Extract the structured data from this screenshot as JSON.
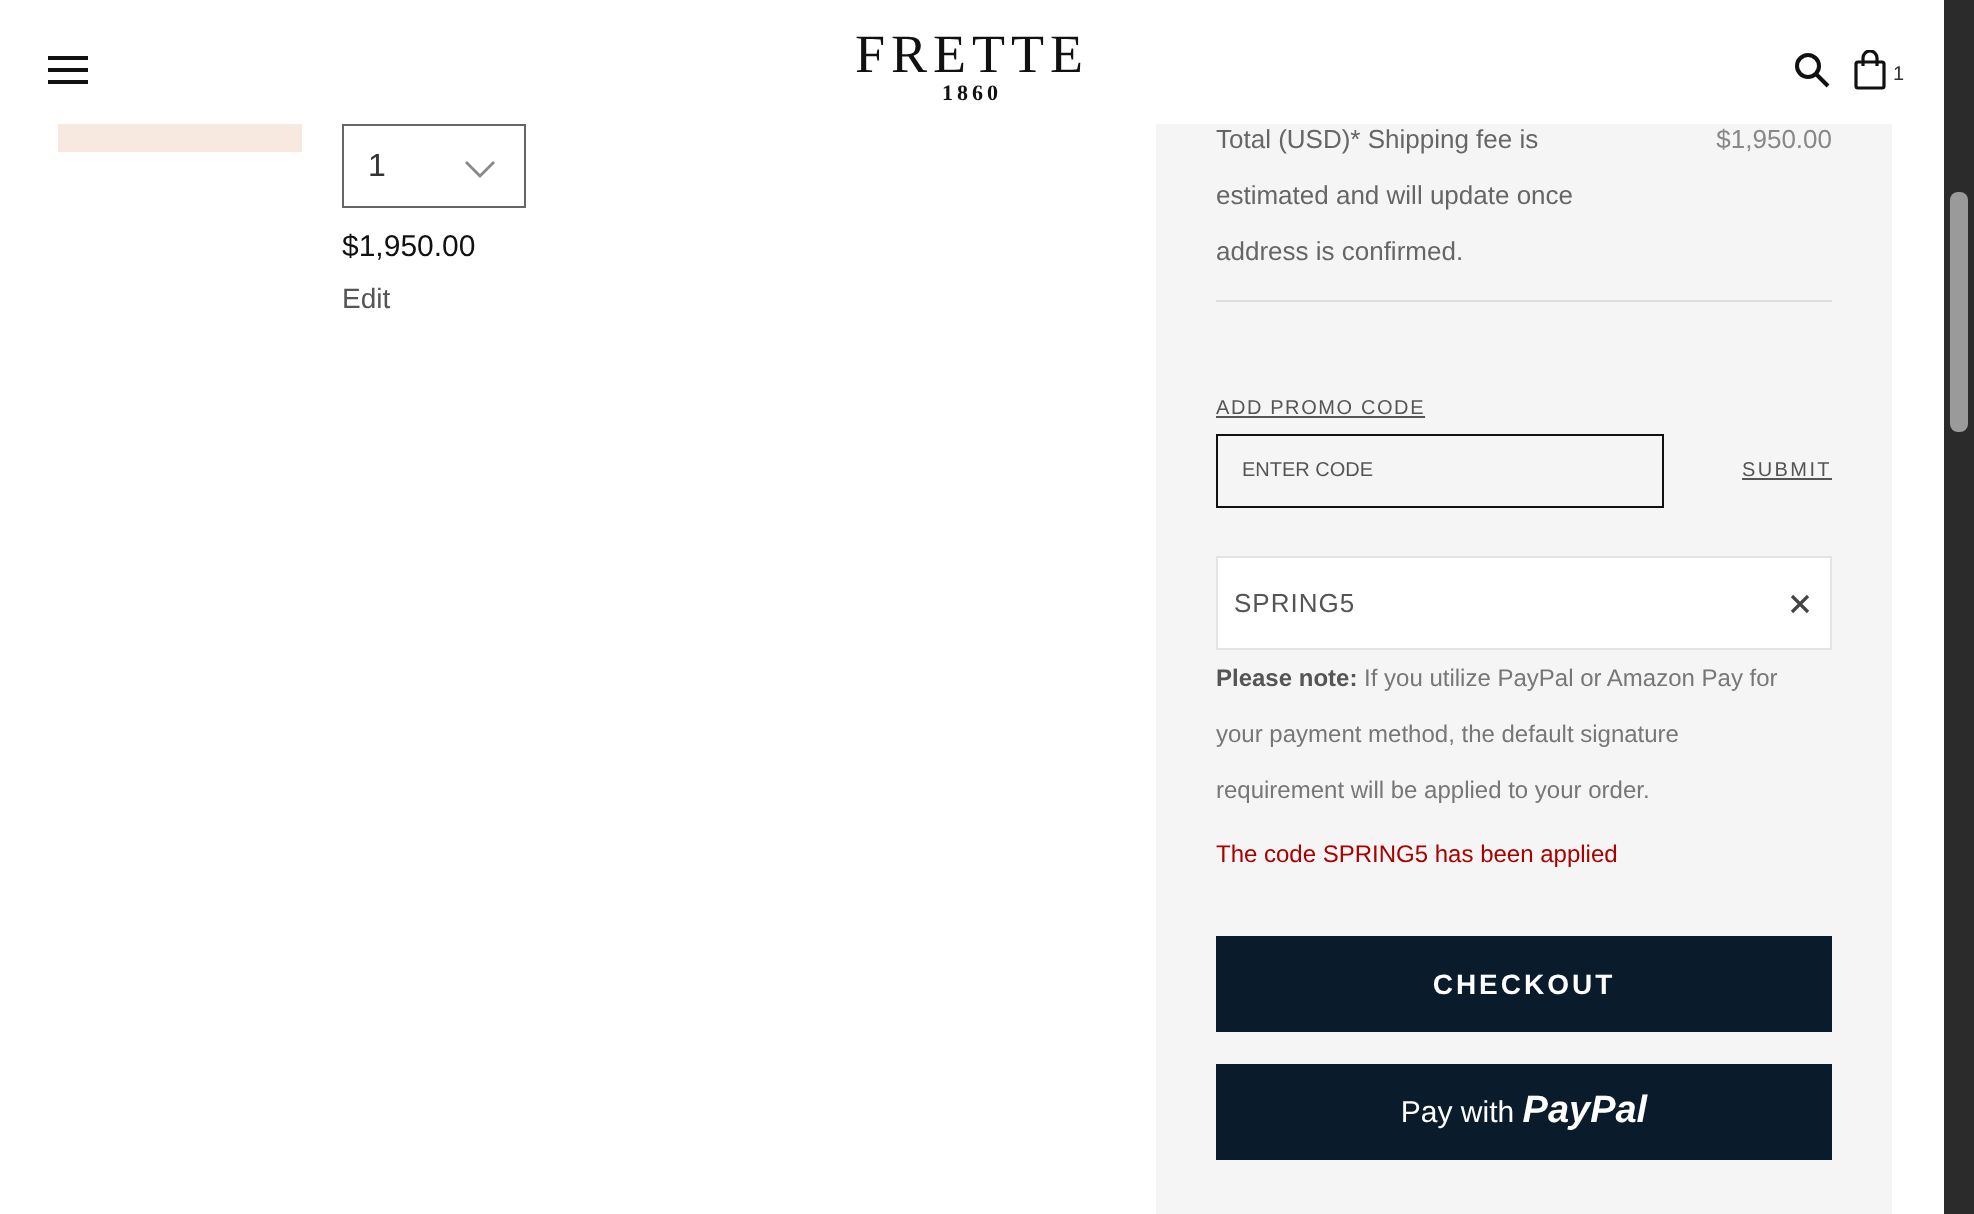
{
  "header": {
    "logo": "FRETTE",
    "logo_year": "1860",
    "cart_count": "1"
  },
  "item": {
    "quantity": "1",
    "price": "$1,950.00",
    "edit": "Edit"
  },
  "summary": {
    "total_note": "Total (USD)* Shipping fee is estimated and will update once address is confirmed.",
    "total_value": "$1,950.00",
    "promo_label": "ADD PROMO CODE",
    "promo_placeholder": "ENTER CODE",
    "submit": "SUBMIT",
    "applied_code": "SPRING5",
    "note": "**Please note:** If you utilize PayPal or Amazon Pay for your payment method, the default signature requirement will be applied to your order.",
    "success": "The code SPRING5 has been applied",
    "checkout": "CHECKOUT",
    "paypal_prefix": "Pay with",
    "paypal_brand": "PayPal"
  }
}
